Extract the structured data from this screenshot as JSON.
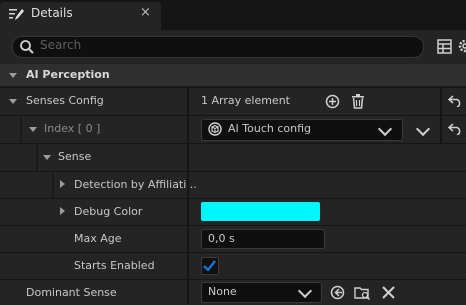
{
  "tab": {
    "title": "Details",
    "close": "×"
  },
  "search": {
    "placeholder": "Search"
  },
  "category": {
    "label": "AI Perception"
  },
  "rows": {
    "senses_config": {
      "label": "Senses Config",
      "value": "1 Array element"
    },
    "index0": {
      "label": "Index [ 0 ]",
      "value": "AI Touch config"
    },
    "sense": {
      "label": "Sense"
    },
    "detection": {
      "label": "Detection by Affiliati..."
    },
    "debug_color": {
      "label": "Debug Color",
      "color": "#00F6FF"
    },
    "max_age": {
      "label": "Max Age",
      "value": "0,0 s"
    },
    "starts_enabled": {
      "label": "Starts Enabled",
      "checked": true
    },
    "dominant_sense": {
      "label": "Dominant Sense",
      "value": "None"
    }
  },
  "colors": {
    "accent_blue": "#1673D6",
    "swatch": "#00F6FF",
    "panel": "#242424",
    "field": "#0F0F0F"
  }
}
